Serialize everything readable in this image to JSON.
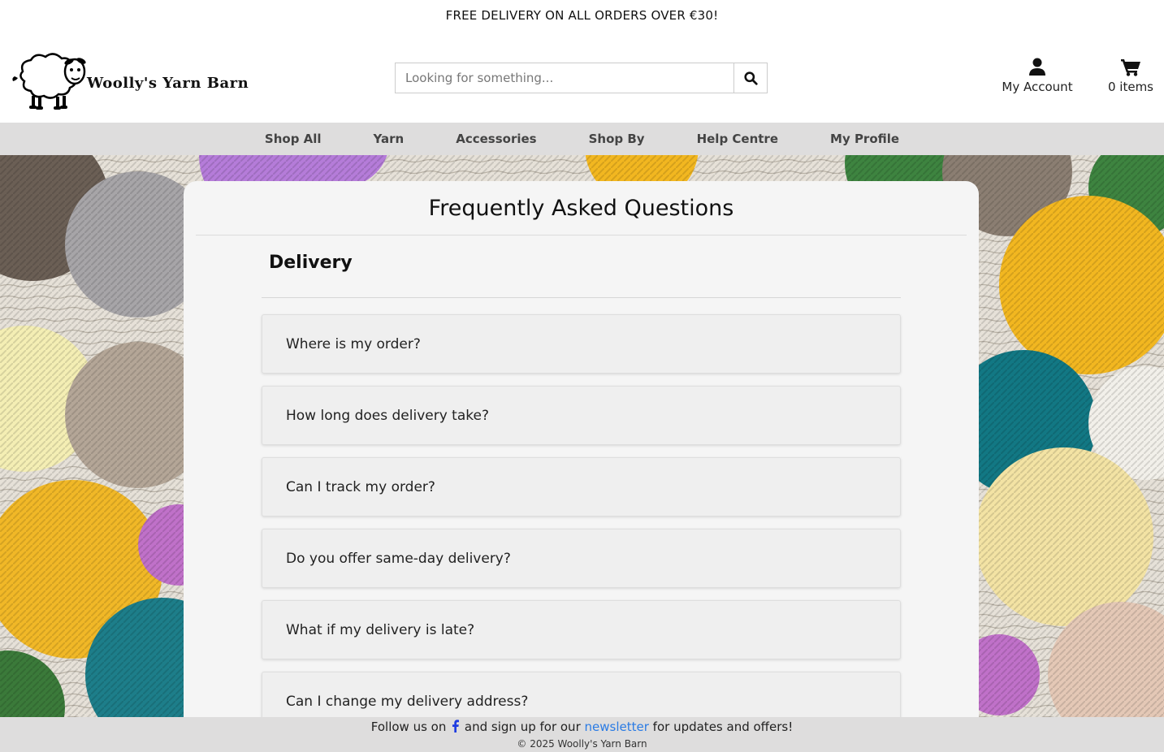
{
  "promo": {
    "text": "FREE DELIVERY ON ALL ORDERS OVER €30!"
  },
  "brand": {
    "name": "Woolly's Yarn Barn",
    "logo_icon": "sheep-icon"
  },
  "search": {
    "placeholder": "Looking for something...",
    "value": "",
    "icon": "search-icon"
  },
  "account": {
    "label": "My Account",
    "icon": "user-icon"
  },
  "cart": {
    "label": "0 items",
    "icon": "cart-icon"
  },
  "nav": {
    "items": [
      {
        "label": "Shop All"
      },
      {
        "label": "Yarn"
      },
      {
        "label": "Accessories"
      },
      {
        "label": "Shop By"
      },
      {
        "label": "Help Centre"
      },
      {
        "label": "My Profile"
      }
    ]
  },
  "faq": {
    "title": "Frequently Asked Questions",
    "section": "Delivery",
    "questions": [
      "Where is my order?",
      "How long does delivery take?",
      "Can I track my order?",
      "Do you offer same-day delivery?",
      "What if my delivery is late?",
      "Can I change my delivery address?"
    ]
  },
  "footer": {
    "follow_prefix": "Follow us on",
    "social_icon": "facebook-icon",
    "signup_text": "and sign up for our",
    "newsletter_link": "newsletter",
    "signup_suffix": "for updates and offers!",
    "copyright": "© 2025 Woolly's Yarn Barn"
  },
  "colors": {
    "nav_bg": "#dedddd",
    "card_bg": "#f5f5f5",
    "link": "#2a7be4",
    "facebook": "#1f3de0"
  }
}
